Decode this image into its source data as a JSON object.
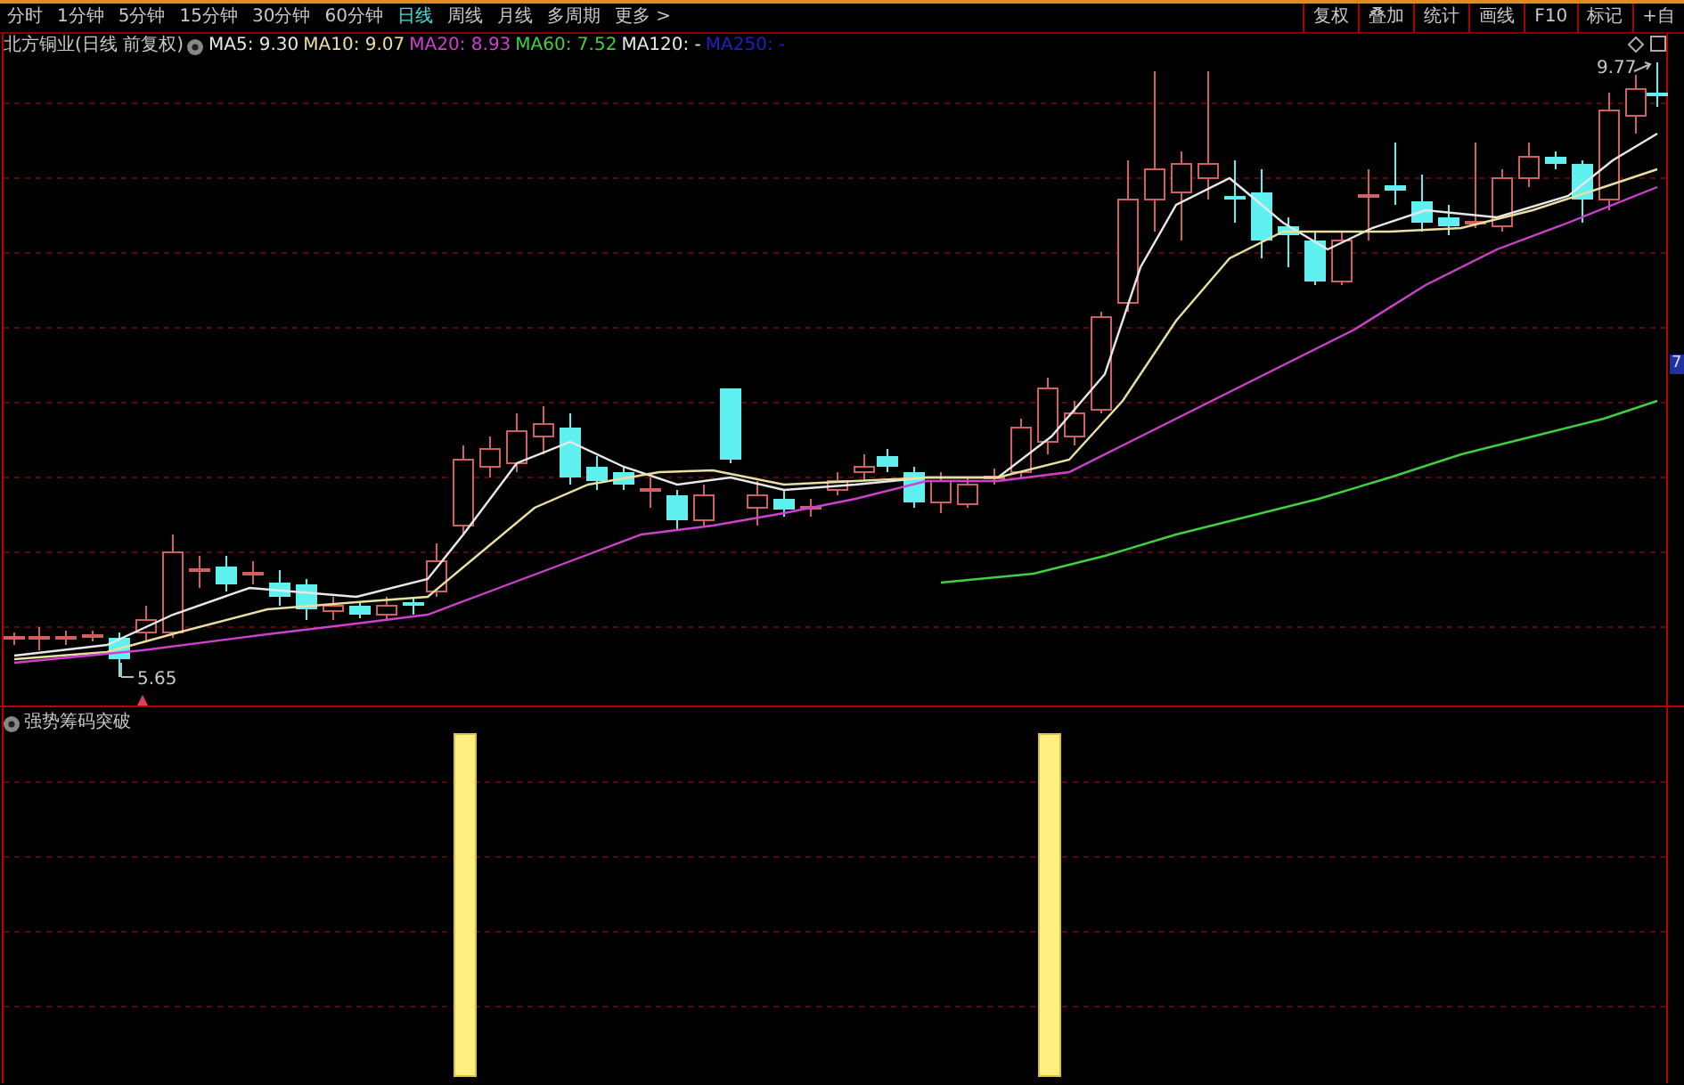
{
  "toolbar": {
    "periods": [
      {
        "label": "分时",
        "selected": false
      },
      {
        "label": "1分钟",
        "selected": false
      },
      {
        "label": "5分钟",
        "selected": false
      },
      {
        "label": "15分钟",
        "selected": false
      },
      {
        "label": "30分钟",
        "selected": false
      },
      {
        "label": "60分钟",
        "selected": false
      },
      {
        "label": "日线",
        "selected": true
      },
      {
        "label": "周线",
        "selected": false
      },
      {
        "label": "月线",
        "selected": false
      },
      {
        "label": "多周期",
        "selected": false
      },
      {
        "label": "更多 >",
        "selected": false
      }
    ],
    "actions": [
      "复权",
      "叠加",
      "统计",
      "画线",
      "F10",
      "标记",
      "+自"
    ]
  },
  "chart": {
    "title": "北方铜业(日线 前复权)",
    "ma_legend": [
      {
        "label": "MA5: 9.30",
        "color": "#e8e8e8"
      },
      {
        "label": "MA10: 9.07",
        "color": "#e8e0a0"
      },
      {
        "label": "MA20: 8.93",
        "color": "#d040d0"
      },
      {
        "label": "MA60: 7.52",
        "color": "#40d040"
      },
      {
        "label": "MA120: -",
        "color": "#e8e8e8"
      },
      {
        "label": "MA250: -",
        "color": "#2020c8"
      }
    ],
    "high_label": "9.77",
    "low_label": "5.65",
    "side_tag": "7"
  },
  "indicator": {
    "title": "强势筹码突破"
  }
}
